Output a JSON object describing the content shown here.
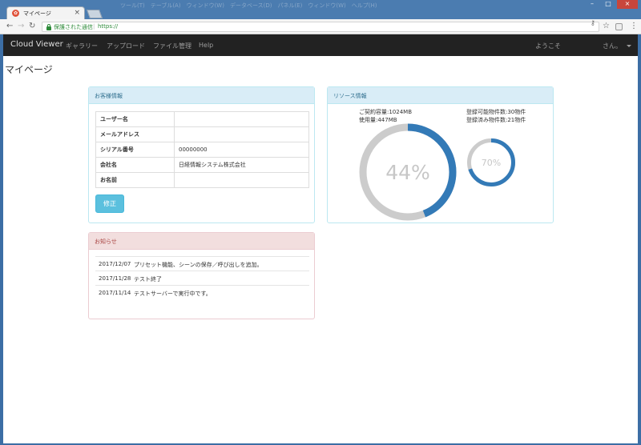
{
  "browser": {
    "tab_title": "マイページ",
    "secure_label": "保護された通信",
    "url": "https://",
    "menu_ghost": "ツール(T)　テーブル(A)　ウィンドウ(W)　データベース(D)　パネル(E)　ウィンドウ(W)　ヘルプ(H)"
  },
  "navbar": {
    "brand": "Cloud Viewer",
    "links": [
      "ギャラリー",
      "アップロード",
      "ファイル管理",
      "Help"
    ],
    "welcome": "ようこそ",
    "user": "さん。"
  },
  "page": {
    "title": "マイページ"
  },
  "customer": {
    "heading": "お客様情報",
    "rows": [
      {
        "label": "ユーザー名",
        "value": ""
      },
      {
        "label": "メールアドレス",
        "value": ""
      },
      {
        "label": "シリアル番号",
        "value": "00000000"
      },
      {
        "label": "会社名",
        "value": "日経情報システム株式会社"
      },
      {
        "label": "お名前",
        "value": ""
      }
    ],
    "edit_button": "修正"
  },
  "resource": {
    "heading": "リソース情報",
    "contract_capacity": "ご契約容量:1024MB",
    "usage": "使用量:447MB",
    "registrable": "登録可能物件数:30物件",
    "registered": "登録済み物件数:21物件",
    "storage_percent_label": "44%",
    "storage_fraction": 0.44,
    "items_percent_label": "70%",
    "items_fraction": 0.7,
    "colors": {
      "fill": "#337ab7",
      "track": "#cccccc"
    }
  },
  "news": {
    "heading": "お知らせ",
    "items": [
      {
        "date": "2017/12/07",
        "text": "プリセット機能、シーンの保存／呼び出しを追加。"
      },
      {
        "date": "2017/11/28",
        "text": "テスト終了"
      },
      {
        "date": "2017/11/14",
        "text": "テストサーバーで実行中です。"
      }
    ]
  }
}
